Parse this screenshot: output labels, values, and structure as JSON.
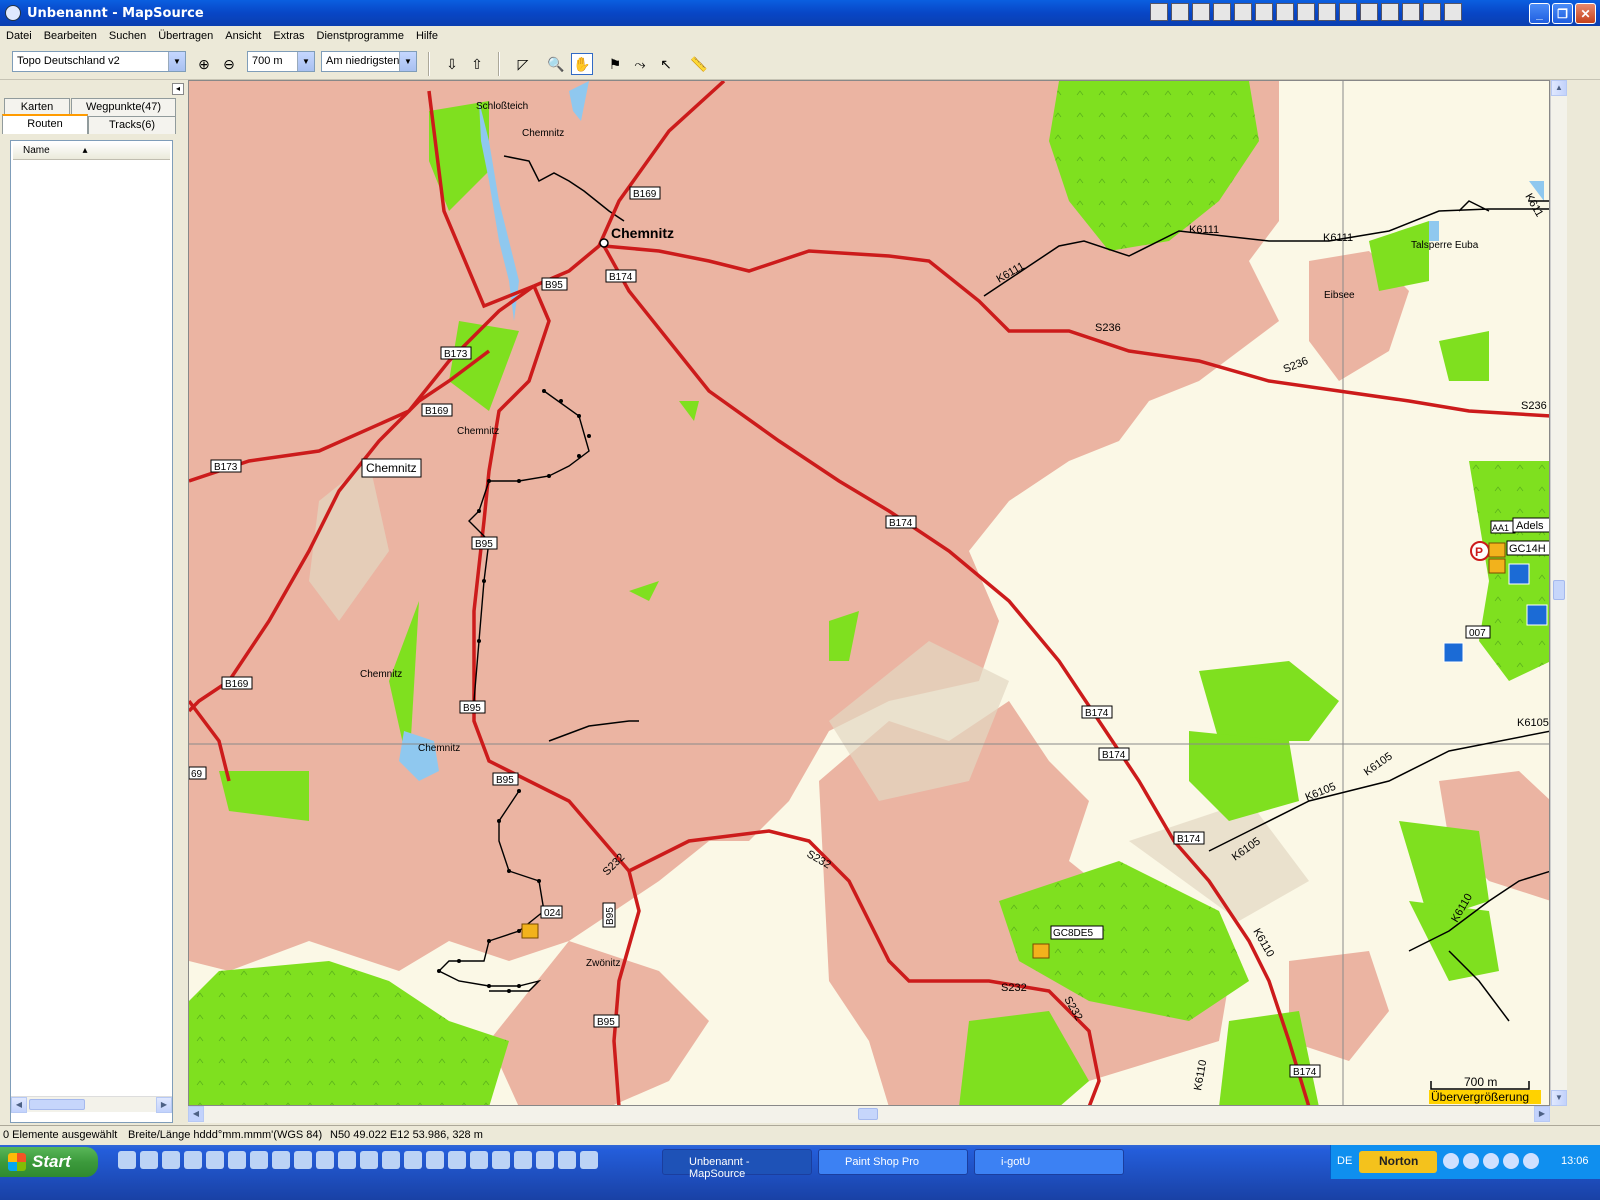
{
  "window": {
    "title": "Unbenannt - MapSource"
  },
  "menu": [
    "Datei",
    "Bearbeiten",
    "Suchen",
    "Übertragen",
    "Ansicht",
    "Extras",
    "Dienstprogramme",
    "Hilfe"
  ],
  "toolbar": {
    "map_product": "Topo Deutschland v2",
    "zoom_level": "700 m",
    "detail_level": "Am niedrigsten"
  },
  "left_panel": {
    "tabs": {
      "karten": "Karten",
      "wegpunkte": "Wegpunkte(47)",
      "routen": "Routen",
      "tracks": "Tracks(6)"
    },
    "list_header": "Name"
  },
  "map": {
    "labels": {
      "schlossteich": "Schloßteich",
      "chemnitz_river_1": "Chemnitz",
      "chemnitz_city": "Chemnitz",
      "chemnitz_river_2": "Chemnitz",
      "chemnitz_box": "Chemnitz",
      "chemnitz_river_3": "Chemnitz",
      "chemnitz_river_4": "Chemnitz",
      "talsperre_euba": "Talsperre Euba",
      "eibsee": "Eibsee",
      "zwoenitz": "Zwönitz"
    },
    "road_shields": {
      "b169_top": "B169",
      "b174_top": "B174",
      "b95_top": "B95",
      "b173_a": "B173",
      "b169_mid": "B169",
      "b173_left": "B173",
      "b95_mid": "B95",
      "b169_left": "B169",
      "b95_low": "B95",
      "b69_edge": "69",
      "b95_bottom": "B95",
      "b174_mid": "B174",
      "b174_r1": "B174",
      "b174_r2": "B174",
      "b174_r3": "B174",
      "b174_bottom": "B174",
      "b95_vert": "B95",
      "b95_last": "B95"
    },
    "road_texts": {
      "k6111_a": "K6111",
      "k6111_b": "K6111",
      "k6111_c": "K6111",
      "k611_edge": "K611",
      "s236_a": "S236",
      "s236_b": "S236",
      "s236_c": "S236",
      "s232_a": "S232",
      "s232_b": "S232",
      "s232_c": "S232",
      "s232_d": "S232",
      "k6105_a": "K6105",
      "k6105_b": "K6105",
      "k6105_c": "K6105",
      "k6105_edge": "K6105",
      "k6110_a": "K6110",
      "k6110_b": "K6110",
      "k6110_c": "K6110"
    },
    "waypoints": {
      "w024": "024",
      "gc8de5": "GC8DE5",
      "w007": "007",
      "adels": "Adels",
      "gc14h": "GC14H",
      "aa1": "AA1"
    },
    "scale": {
      "distance": "700 m",
      "mode": "Übervergrößerung"
    }
  },
  "status": {
    "selected": "0 Elemente ausgewählt",
    "format": "Breite/Länge hddd°mm.mmm'(WGS 84)",
    "position": "N50 49.022 E12 53.986, 328 m"
  },
  "taskbar": {
    "start": "Start",
    "tasks": [
      "Unbenannt - MapSource",
      "Paint Shop Pro",
      "i-gotU"
    ],
    "lang": "DE",
    "norton": "Norton",
    "clock": "13:06"
  },
  "colors": {
    "urban": "#ebb4a2",
    "forest": "#7fe01f",
    "road_main": "#cc1b1b",
    "road_minor": "#000000",
    "water": "#8fc8ef",
    "track": "#000000"
  }
}
